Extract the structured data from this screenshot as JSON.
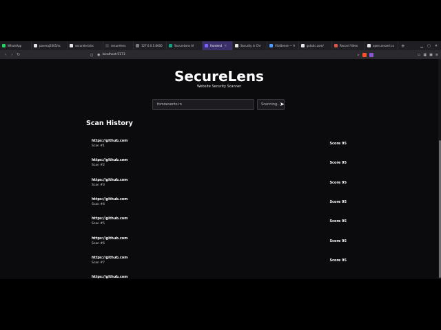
{
  "browser": {
    "tabs": [
      {
        "label": "WhatsApp",
        "color": "#25d366",
        "active": false
      },
      {
        "label": "paveraj2005/sc",
        "color": "#e6e6e6",
        "active": false
      },
      {
        "label": "secureleris/sc",
        "color": "#e6e6e6",
        "active": false
      },
      {
        "label": "securelens",
        "color": "#3d3d44",
        "active": false
      },
      {
        "label": "127.0.0.1:8000",
        "color": "#7a7a82",
        "active": false
      },
      {
        "label": "SecureLens AI",
        "color": "#10a37f",
        "active": false
      },
      {
        "label": "frontend",
        "color": "#7b61ff",
        "active": true
      },
      {
        "label": "Security in Chr",
        "color": "#e6e6e6",
        "active": false
      },
      {
        "label": "VitaSense — A",
        "color": "#4a9eff",
        "active": false
      },
      {
        "label": "gstatic.com/",
        "color": "#e6e6e6",
        "active": false
      },
      {
        "label": "Record Video",
        "color": "#e0534a",
        "active": false
      },
      {
        "label": "open zeroerl.co",
        "color": "#e6e6e6",
        "active": false
      }
    ],
    "new_tab": "+",
    "url": "localhost:5173"
  },
  "app": {
    "title": "SecureLens",
    "subtitle": "Website Security Scanner",
    "search": {
      "value": "fomoevents.in",
      "placeholder": ""
    },
    "scan_button": "Scanning...",
    "history_heading": "Scan History",
    "history": [
      {
        "url": "https://github.com",
        "label": "Scan #1",
        "score": "Score 95"
      },
      {
        "url": "https://github.com",
        "label": "Scan #2",
        "score": "Score 95"
      },
      {
        "url": "https://github.com",
        "label": "Scan #3",
        "score": "Score 95"
      },
      {
        "url": "https://github.com",
        "label": "Scan #4",
        "score": "Score 95"
      },
      {
        "url": "https://github.com",
        "label": "Scan #5",
        "score": "Score 95"
      },
      {
        "url": "https://github.com",
        "label": "Scan #6",
        "score": "Score 95"
      },
      {
        "url": "https://github.com",
        "label": "Scan #7",
        "score": "Score 95"
      },
      {
        "url": "https://github.com",
        "label": "",
        "score": ""
      }
    ]
  }
}
